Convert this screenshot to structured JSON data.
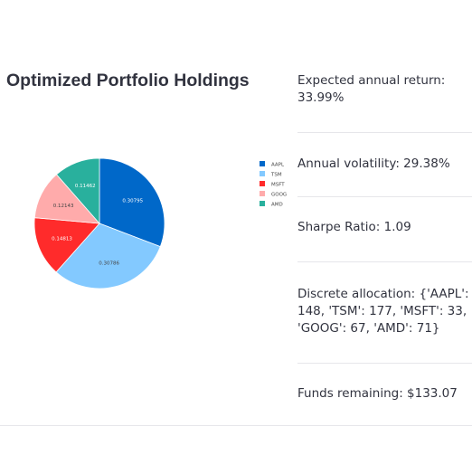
{
  "title": "Optimized Portfolio Holdings",
  "chart_data": {
    "type": "pie",
    "title": "",
    "labels": [
      "AAPL",
      "TSM",
      "MSFT",
      "GOOG",
      "AMD"
    ],
    "values": [
      0.30795,
      0.30786,
      0.14813,
      0.12143,
      0.11462
    ],
    "value_labels": [
      "0.30795",
      "0.30786",
      "0.14813",
      "0.12143",
      "0.11462"
    ],
    "colors": [
      "#0068c9",
      "#83c9ff",
      "#ff2b2b",
      "#ffabab",
      "#29b09d"
    ],
    "legend_position": "right",
    "start_angle_deg": 0,
    "direction": "clockwise"
  },
  "metrics": {
    "expected_return": "Expected annual return: 33.99%",
    "volatility": "Annual volatility: 29.38%",
    "sharpe": "Sharpe Ratio: 1.09",
    "allocation": "Discrete allocation: {'AAPL': 148, 'TSM': 177, 'MSFT': 33, 'GOOG': 67, 'AMD': 71}",
    "funds_remaining": "Funds remaining: $133.07"
  }
}
